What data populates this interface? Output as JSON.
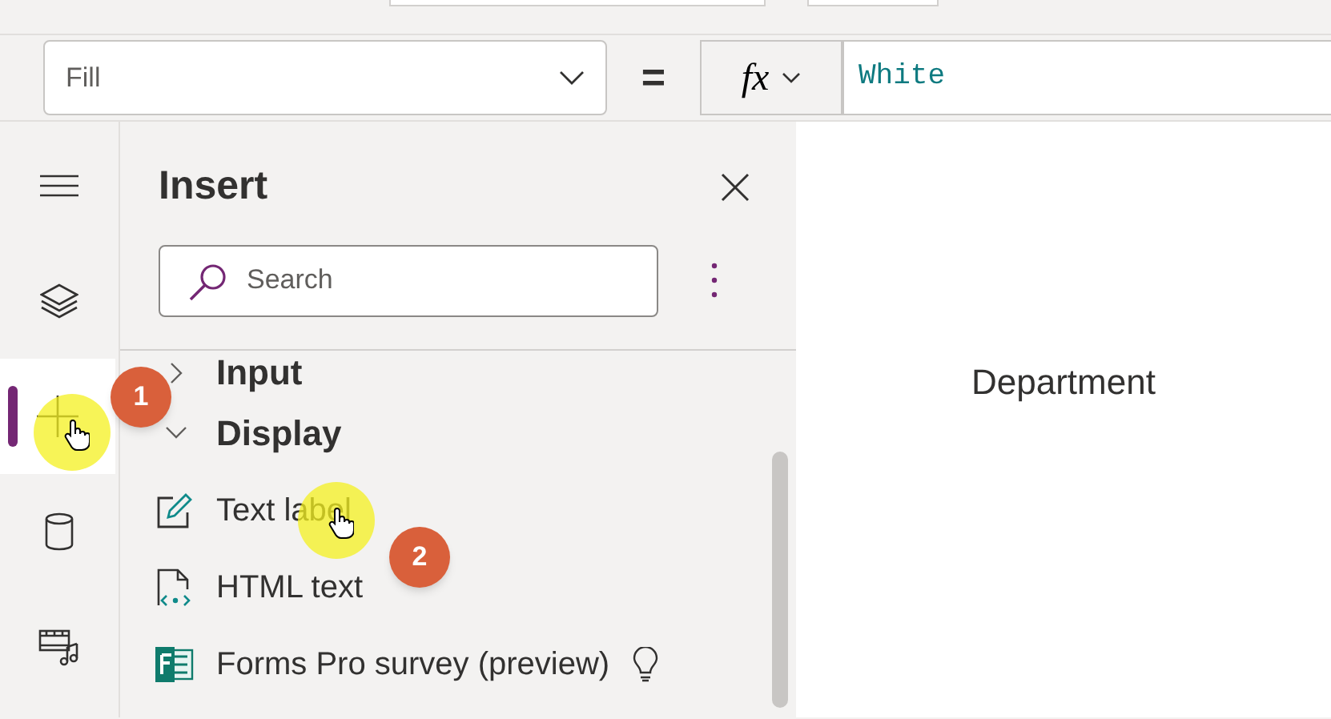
{
  "property_dropdown": {
    "value": "Fill"
  },
  "equals": "=",
  "fx_button": {
    "label": "fx"
  },
  "formula": {
    "value": "White"
  },
  "rail": [
    {
      "kind": "menu",
      "selected": false
    },
    {
      "kind": "layers",
      "selected": false
    },
    {
      "kind": "insert",
      "selected": true
    },
    {
      "kind": "data",
      "selected": false
    },
    {
      "kind": "media",
      "selected": false
    }
  ],
  "panel": {
    "title": "Insert",
    "search": {
      "placeholder": "Search"
    },
    "tree": [
      {
        "label": "Input",
        "expanded": false
      },
      {
        "label": "Display",
        "expanded": true,
        "children": [
          {
            "label": "Text label",
            "kind": "label"
          },
          {
            "label": "HTML text",
            "kind": "html"
          },
          {
            "label": "Forms Pro survey (preview)",
            "kind": "forms"
          }
        ]
      }
    ]
  },
  "canvas": {
    "label": "Department"
  },
  "callouts": [
    {
      "number": "1"
    },
    {
      "number": "2"
    }
  ]
}
